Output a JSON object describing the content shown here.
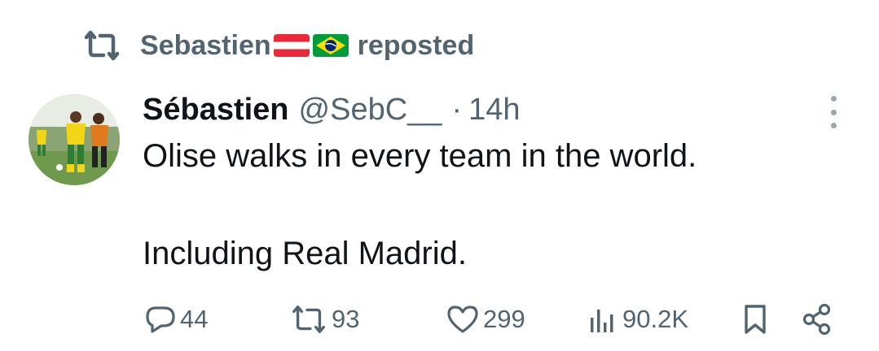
{
  "repost": {
    "user": "Sebastien",
    "flags": [
      "austria-flag",
      "brazil-flag"
    ],
    "label": "reposted",
    "icon": "repost-icon"
  },
  "tweet": {
    "avatar": "avatar",
    "display_name": "Sébastien",
    "handle": "@SebC__",
    "separator": "·",
    "time": "14h",
    "text_line_1": "Olise walks in every team in the world.",
    "text_line_2": "Including Real Madrid."
  },
  "actions": {
    "replies": "44",
    "reposts": "93",
    "likes": "299",
    "views": "90.2K"
  },
  "colors": {
    "text": "#0f1419",
    "secondary": "#536471",
    "background": "#ffffff"
  }
}
